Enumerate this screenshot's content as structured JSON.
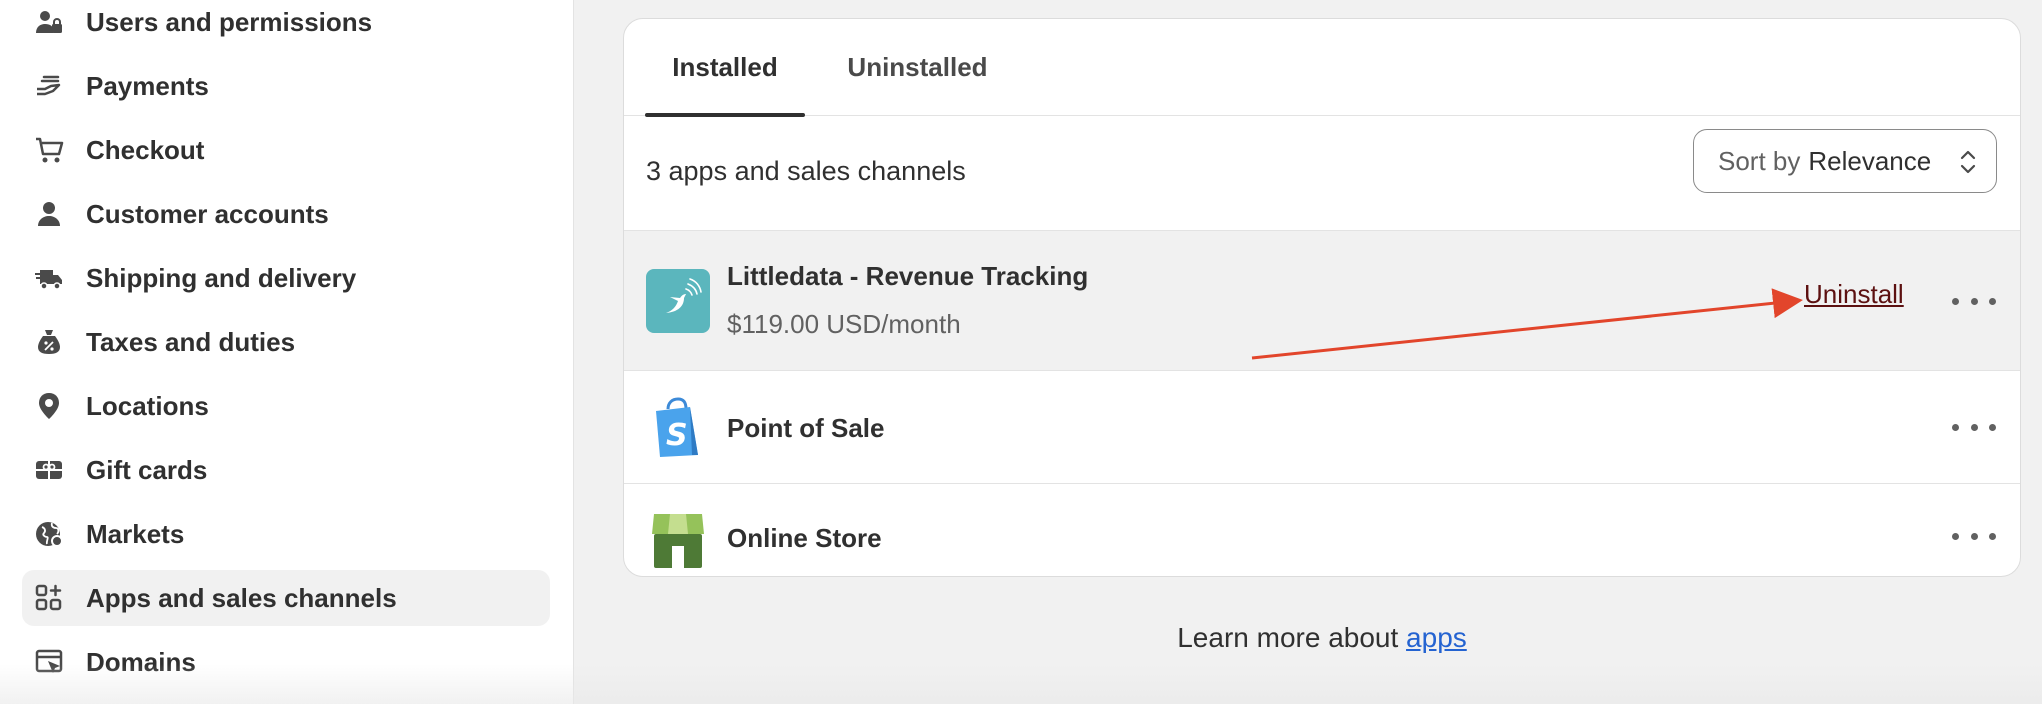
{
  "sidebar": {
    "items": [
      {
        "label": "Users and permissions",
        "icon": "user-lock-icon",
        "active": false
      },
      {
        "label": "Payments",
        "icon": "payment-hand-icon",
        "active": false
      },
      {
        "label": "Checkout",
        "icon": "cart-icon",
        "active": false
      },
      {
        "label": "Customer accounts",
        "icon": "person-icon",
        "active": false
      },
      {
        "label": "Shipping and delivery",
        "icon": "truck-icon",
        "active": false
      },
      {
        "label": "Taxes and duties",
        "icon": "tax-bag-icon",
        "active": false
      },
      {
        "label": "Locations",
        "icon": "location-pin-icon",
        "active": false
      },
      {
        "label": "Gift cards",
        "icon": "gift-card-icon",
        "active": false
      },
      {
        "label": "Markets",
        "icon": "globe-icon",
        "active": false
      },
      {
        "label": "Apps and sales channels",
        "icon": "apps-grid-icon",
        "active": true
      },
      {
        "label": "Domains",
        "icon": "domains-icon",
        "active": false
      }
    ]
  },
  "tabs": [
    {
      "label": "Installed",
      "active": true
    },
    {
      "label": "Uninstalled",
      "active": false
    }
  ],
  "summary": "3 apps and sales channels",
  "sort": {
    "prefix": "Sort by",
    "value": "Relevance"
  },
  "apps": [
    {
      "name": "Littledata - Revenue Tracking",
      "price": "$119.00 USD/month",
      "icon": "littledata-bird-icon",
      "action": "Uninstall"
    },
    {
      "name": "Point of Sale",
      "icon": "shopify-bag-icon"
    },
    {
      "name": "Online Store",
      "icon": "online-store-icon"
    }
  ],
  "footer": {
    "text": "Learn more about ",
    "link": "apps"
  },
  "colors": {
    "accent_link": "#2463d1",
    "annotation_arrow": "#e2452b",
    "littledata_bg": "#5bb6bd"
  }
}
